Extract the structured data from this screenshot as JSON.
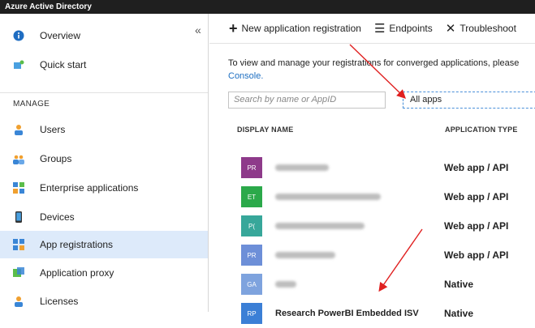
{
  "window": {
    "title": "Azure Active Directory"
  },
  "sidebar": {
    "collapse_glyph": "«",
    "top_items": [
      {
        "label": "Overview",
        "icon": "info-icon"
      },
      {
        "label": "Quick start",
        "icon": "rocket-icon"
      }
    ],
    "section_label": "MANAGE",
    "items": [
      {
        "label": "Users",
        "icon": "user-icon"
      },
      {
        "label": "Groups",
        "icon": "groups-icon"
      },
      {
        "label": "Enterprise applications",
        "icon": "enterprise-apps-icon"
      },
      {
        "label": "Devices",
        "icon": "device-icon"
      },
      {
        "label": "App registrations",
        "icon": "app-registrations-icon",
        "active": true
      },
      {
        "label": "Application proxy",
        "icon": "application-proxy-icon"
      },
      {
        "label": "Licenses",
        "icon": "licenses-icon"
      }
    ]
  },
  "toolbar": {
    "new_app_label": "New application registration",
    "endpoints_label": "Endpoints",
    "troubleshoot_label": "Troubleshoot"
  },
  "content": {
    "description": "To view and manage your registrations for converged applications, please",
    "description_link": "Console.",
    "search_placeholder": "Search by name or AppID",
    "filter_value": "All apps",
    "columns": {
      "name": "DISPLAY NAME",
      "type": "APPLICATION TYPE"
    },
    "rows": [
      {
        "initials": "PR",
        "color": "#8e3a8a",
        "name": "",
        "type": "Web app / API"
      },
      {
        "initials": "ET",
        "color": "#2ba94a",
        "name": "",
        "type": "Web app / API"
      },
      {
        "initials": "P(",
        "color": "#37a79a",
        "name": "",
        "type": "Web app / API"
      },
      {
        "initials": "PR",
        "color": "#6d8fd8",
        "name": "",
        "type": "Web app / API"
      },
      {
        "initials": "GA",
        "color": "#7ea3de",
        "name": "",
        "type": "Native"
      },
      {
        "initials": "RP",
        "color": "#3b7fd6",
        "name": "Research PowerBI Embedded ISV",
        "type": "Native"
      }
    ]
  },
  "colors": {
    "annotation_arrow": "#e02020",
    "active_nav": "#ddeafa",
    "link": "#1e6fc2"
  }
}
